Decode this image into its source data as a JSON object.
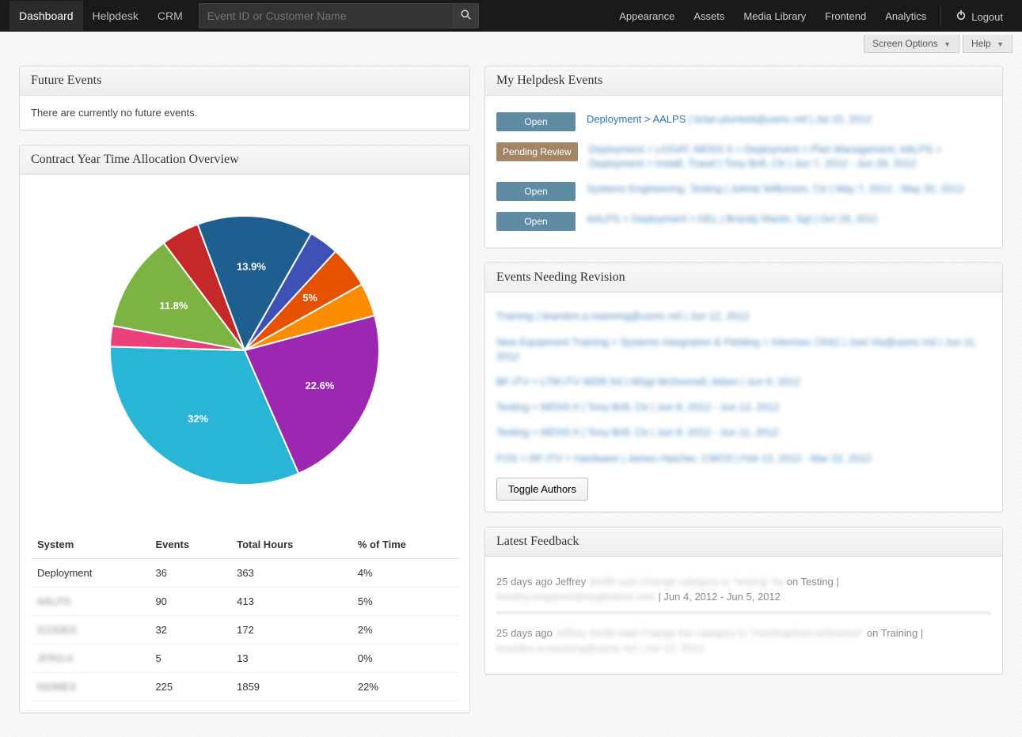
{
  "topbar": {
    "left": [
      {
        "label": "Dashboard",
        "active": true
      },
      {
        "label": "Helpdesk",
        "active": false
      },
      {
        "label": "CRM",
        "active": false
      }
    ],
    "search_placeholder": "Event ID or Customer Name",
    "right": [
      {
        "label": "Appearance"
      },
      {
        "label": "Assets"
      },
      {
        "label": "Media Library"
      },
      {
        "label": "Frontend"
      },
      {
        "label": "Analytics"
      }
    ],
    "logout": "Logout"
  },
  "subbar": {
    "screen_options": "Screen Options",
    "help": "Help"
  },
  "future_events": {
    "title": "Future Events",
    "body": "There are currently no future events."
  },
  "allocation": {
    "title": "Contract Year Time Allocation Overview",
    "chart_data": {
      "type": "pie",
      "slices": [
        {
          "label": "22.6%",
          "value": 22.6,
          "color": "#9c27b0",
          "show": true
        },
        {
          "label": "32%",
          "value": 32.0,
          "color": "#29b6d6",
          "show": true
        },
        {
          "label": "",
          "value": 2.5,
          "color": "#ec407a",
          "show": false
        },
        {
          "label": "11.8%",
          "value": 11.8,
          "color": "#7cb342",
          "show": true
        },
        {
          "label": "",
          "value": 4.6,
          "color": "#c62828",
          "show": false
        },
        {
          "label": "13.9%",
          "value": 13.9,
          "color": "#1e5f8f",
          "show": true
        },
        {
          "label": "",
          "value": 3.6,
          "color": "#3f51b5",
          "show": false
        },
        {
          "label": "5%",
          "value": 5.0,
          "color": "#e65100",
          "show": true
        },
        {
          "label": "",
          "value": 4.0,
          "color": "#fb8c00",
          "show": false
        }
      ],
      "start_angle_deg": -15
    },
    "table": {
      "columns": [
        "System",
        "Events",
        "Total Hours",
        "% of Time"
      ],
      "rows": [
        {
          "system": "Deployment",
          "events": "36",
          "hours": "363",
          "pct": "4%",
          "blur": false
        },
        {
          "system": "AALPS",
          "events": "90",
          "hours": "413",
          "pct": "5%",
          "blur": true
        },
        {
          "system": "ICODES",
          "events": "32",
          "hours": "172",
          "pct": "2%",
          "blur": true
        },
        {
          "system": "JFRG-II",
          "events": "5",
          "hours": "13",
          "pct": "0%",
          "blur": true
        },
        {
          "system": "KEIMES",
          "events": "225",
          "hours": "1859",
          "pct": "22%",
          "blur": true
        }
      ]
    }
  },
  "helpdesk": {
    "title": "My Helpdesk Events",
    "rows": [
      {
        "status": "Open",
        "status_class": "open",
        "link": "Deployment > AALPS",
        "tail": " | brian.plunkett@usmc.mil | Jul 15, 2012"
      },
      {
        "status": "Pending Review",
        "status_class": "pending",
        "text": "Deployment > LOGAT, MDSS II > Deployment > Plan Management, AALPS > Deployment > Install, Travel | Tony Brill, Ctr | Jun 7, 2012 - Jun 28, 2012"
      },
      {
        "status": "Open",
        "status_class": "open",
        "text": "Systems Engineering, Testing | Johnie Wilkinson, Ctr | May 7, 2012 - May 30, 2012"
      },
      {
        "status": "Open",
        "status_class": "open",
        "text": "AALPS > Deployment > DEL | Brandy Martin, Sgt | Oct 18, 2011"
      }
    ]
  },
  "revision": {
    "title": "Events Needing Revision",
    "rows": [
      "Training | brandon.a.manning@usmc.mil | Jun 12, 2012",
      "New Equipment Training > Systems Integration & Fielding > Intermec CK61 | Joel.Via@usmc.mil | Jun 11, 2012",
      "BF-ITV > LTM-ITV WDR Kit | MSgt McDonnell, Adam | Jun 9, 2012",
      "Testing > MDSS II | Tony Brill, Ctr | Jun 8, 2012 - Jun 12, 2012",
      "Testing > MDSS II | Tony Brill, Ctr | Jun 8, 2012 - Jun 11, 2012",
      "FOS > RF-ITV > Hardware | James Hatcher, CWO3 | Feb 13, 2012 - Mar 22, 2012"
    ],
    "toggle_label": "Toggle Authors"
  },
  "feedback": {
    "title": "Latest Feedback",
    "items": [
      {
        "prefix": "25 days ago Jeffrey",
        "blur1": " Smith said ",
        "blur2": "Change category to \"testing\" by",
        "mid": " on Testing | ",
        "blur3": "timothy.singstock@ucgfederal.com",
        "dates": " | Jun 4, 2012 - Jun 5, 2012"
      },
      {
        "prefix": "25 days ago ",
        "blur1": "Jeffrey Smith said ",
        "blur2": "Change the category to \"meeting/teleconference\"",
        "mid": " on Training | ",
        "blur3": "brandon.a.manning@usmc.mil | Jun 12, 2012",
        "dates": ""
      }
    ]
  }
}
